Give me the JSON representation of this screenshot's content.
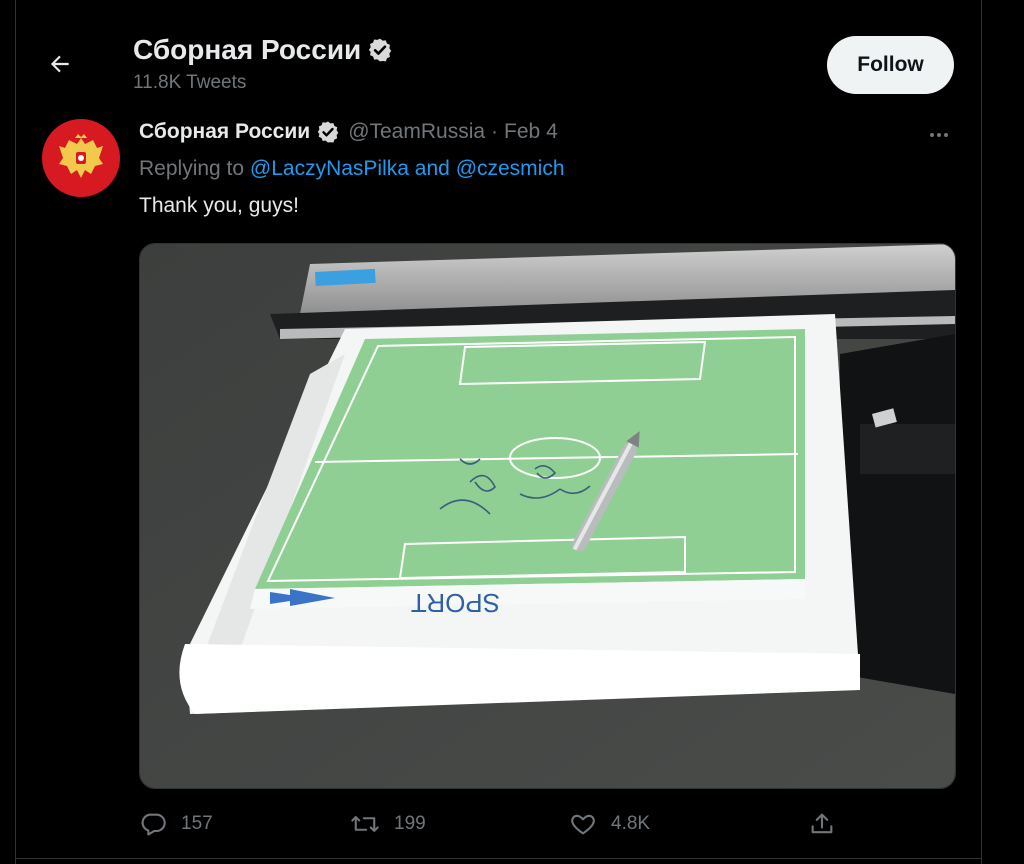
{
  "header": {
    "display_name": "Сборная России",
    "tweet_count": "11.8K Tweets",
    "follow_label": "Follow",
    "back_icon": "arrow-left-icon"
  },
  "tweet": {
    "display_name": "Сборная России",
    "handle": "@TeamRussia",
    "separator": "·",
    "date": "Feb 4",
    "replying_prefix": "Replying to",
    "reply_to_1": "@LaczyNasPilka",
    "reply_joiner": "and",
    "reply_to_2": "@czesmich",
    "text": "Thank you, guys!",
    "media_brand_text": "SPORT",
    "verified_icon": "verified-badge-icon"
  },
  "actions": {
    "replies": "157",
    "retweets": "199",
    "likes": "4.8K",
    "share_icon": "share-icon"
  },
  "colors": {
    "background": "#000000",
    "text_primary": "#e7e9ea",
    "text_secondary": "#71767b",
    "link": "#1d9bf0",
    "follow_bg": "#eff3f4",
    "avatar_bg": "#d71a21"
  }
}
